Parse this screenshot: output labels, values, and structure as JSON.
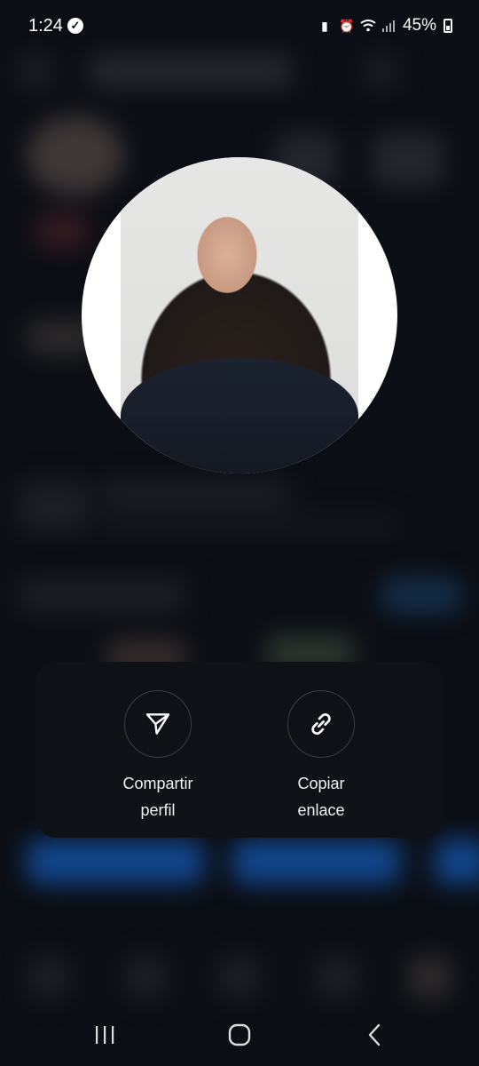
{
  "status_bar": {
    "time": "1:24",
    "battery_percent": "45%",
    "icons": [
      "verified-check-icon",
      "battery-saver-icon",
      "alarm-icon",
      "wifi-icon",
      "signal-icon",
      "battery-icon"
    ]
  },
  "profile_picture": {
    "alt": "profile-photo"
  },
  "share_sheet": {
    "actions": [
      {
        "icon": "send-icon",
        "label": "Compartir\nperfil"
      },
      {
        "icon": "link-icon",
        "label": "Copiar\nenlace"
      }
    ]
  },
  "colors": {
    "background": "#0d1117",
    "sheet": "#0e1116",
    "accent": "#1877f2"
  },
  "nav_bar": {
    "buttons": [
      "recents-icon",
      "home-icon",
      "back-icon"
    ]
  }
}
